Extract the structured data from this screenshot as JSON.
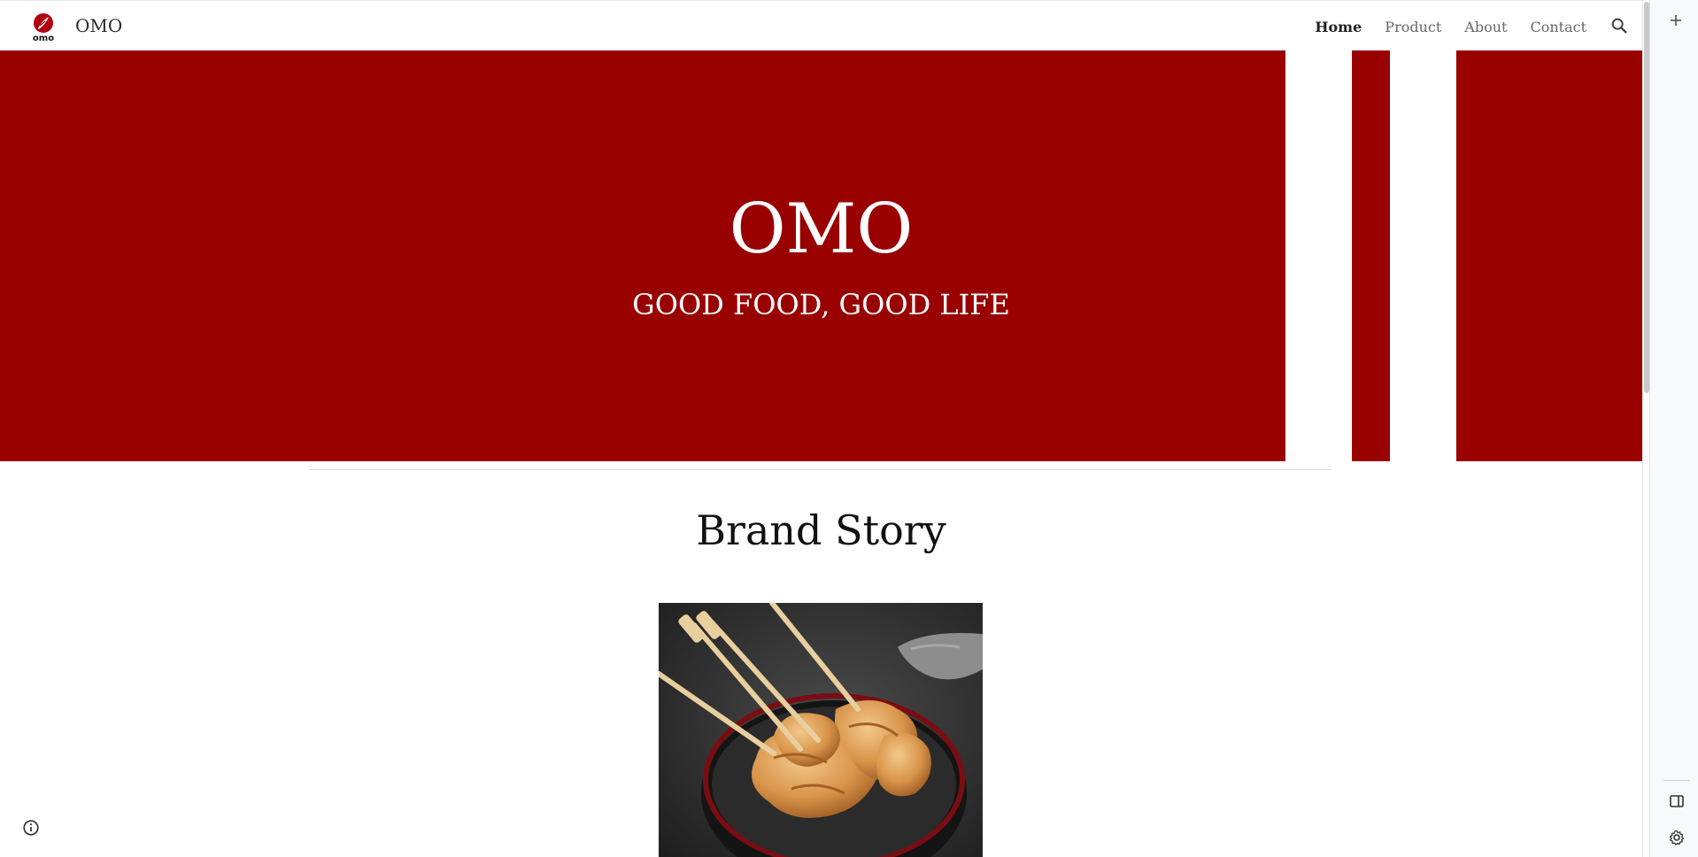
{
  "header": {
    "site_title": "OMO",
    "logo_icon": "omo-logo-icon",
    "nav": [
      {
        "label": "Home",
        "active": true
      },
      {
        "label": "Product",
        "active": false
      },
      {
        "label": "About",
        "active": false
      },
      {
        "label": "Contact",
        "active": false
      }
    ],
    "search_icon": "search-icon"
  },
  "hero": {
    "title": "OMO",
    "subtitle": "GOOD FOOD, GOOD LIFE",
    "background_color": "#990000"
  },
  "brand_story": {
    "title": "Brand Story",
    "image_icon": "fish-cake-skewers-image"
  },
  "side_rail": {
    "icons": [
      "add-icon",
      "side-panel-icon",
      "settings-icon"
    ]
  },
  "footer": {
    "info_icon": "info-icon"
  },
  "colors": {
    "brand_red": "#990000",
    "text_dark": "#222222",
    "nav_text": "#666666"
  }
}
